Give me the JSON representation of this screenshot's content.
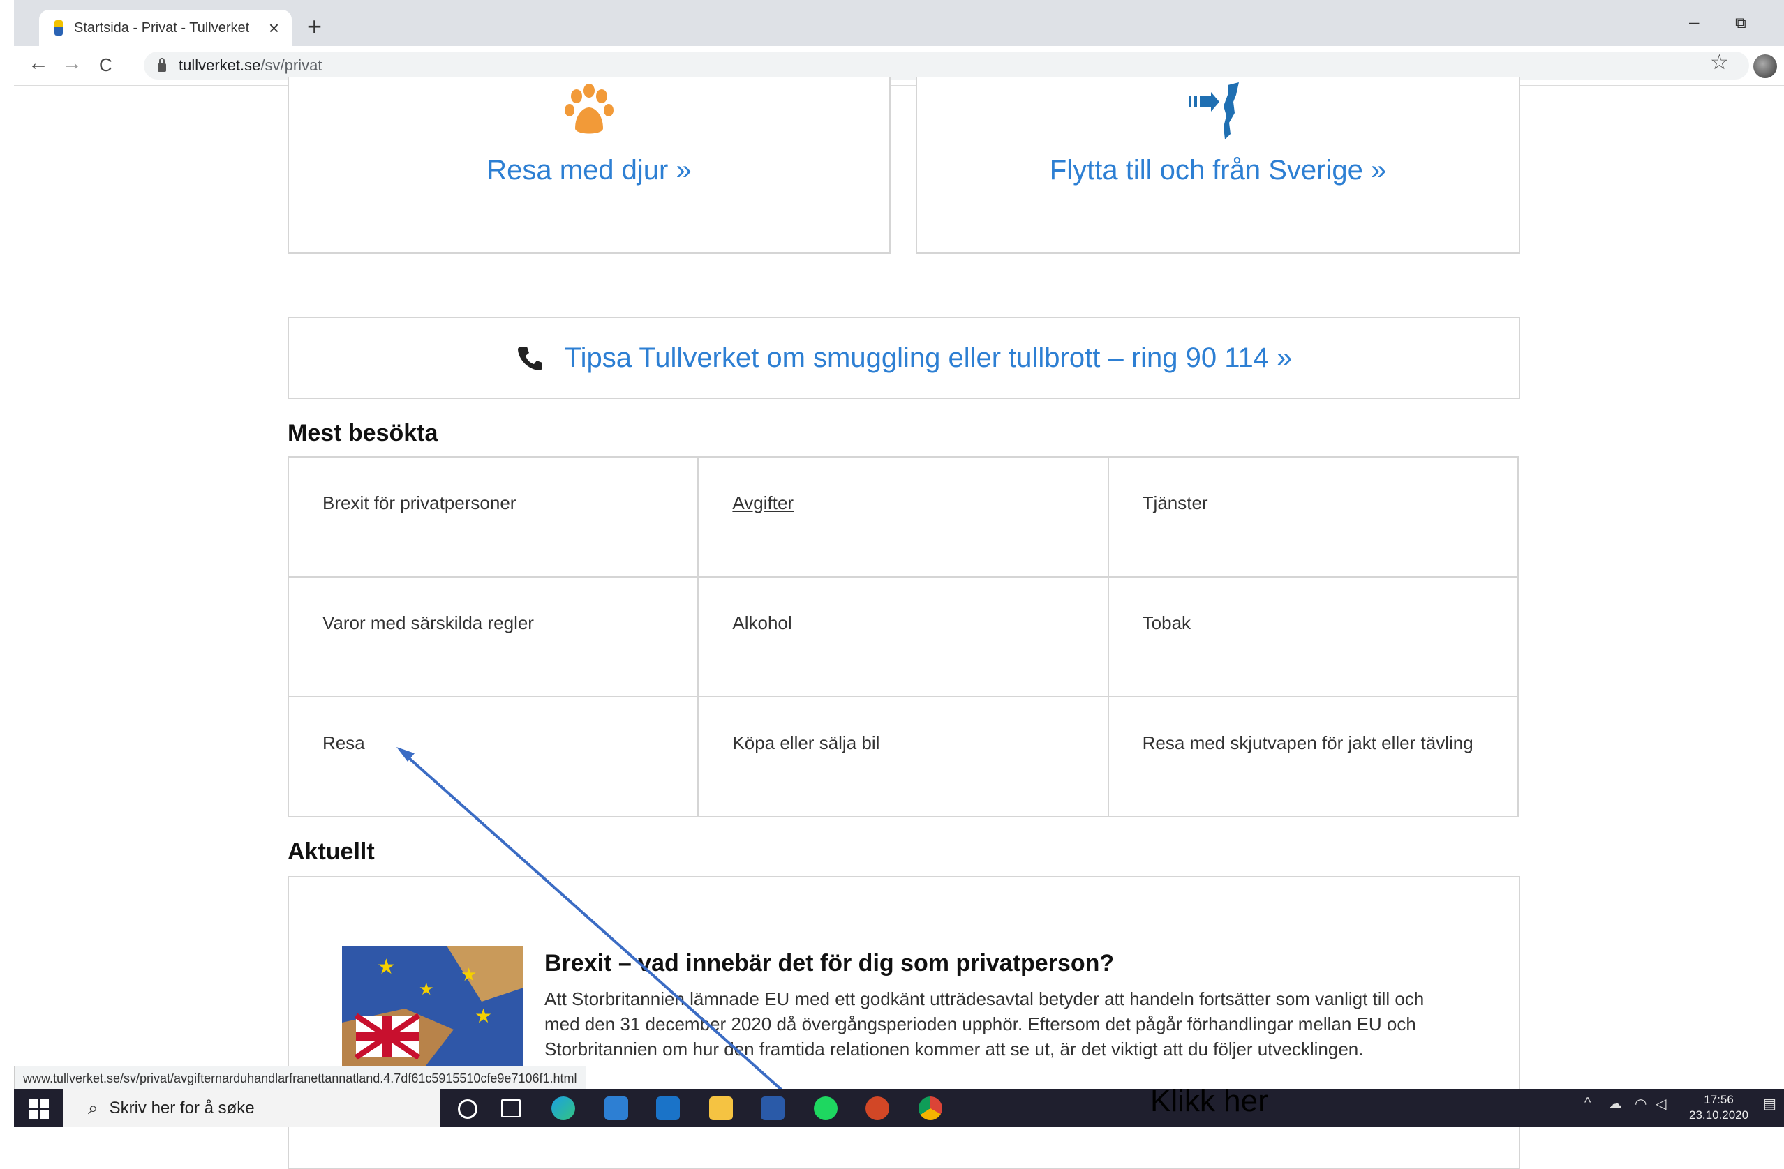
{
  "browser": {
    "tab_title": "Startsida - Privat - Tullverket",
    "tab_close": "×",
    "new_tab": "+",
    "url_domain": "tullverket.se",
    "url_path": "/sv/privat",
    "back": "←",
    "forward": "→",
    "reload": "C",
    "minimize": "–",
    "restore": "⧉",
    "star": "☆"
  },
  "cards": {
    "pets_label": "Resa med djur »",
    "move_label": "Flytta till och från Sverige »"
  },
  "tip": {
    "text": "Tipsa Tullverket om smuggling eller tullbrott – ring 90 114  »"
  },
  "most_visited": {
    "heading": "Mest besökta",
    "items": [
      "Brexit för privatpersoner",
      "Avgifter",
      "Tjänster",
      "Varor med särskilda regler",
      "Alkohol",
      "Tobak",
      "Resa",
      "Köpa eller sälja bil",
      "Resa med skjutvapen för jakt eller tävling"
    ]
  },
  "news": {
    "heading": "Aktuellt",
    "title": "Brexit – vad innebär det för dig som privatperson?",
    "body": "Att Storbritannien lämnade EU med ett godkänt utträdesavtal betyder att handeln fortsätter som vanligt till och med den 31 december 2020 då övergångsperioden upphör. Eftersom det pågår förhandlingar mellan EU och Storbritannien om hur den framtida relationen kommer att se ut, är det viktigt att du följer utvecklingen."
  },
  "status_url": "www.tullverket.se/sv/privat/avgifternarduhandlarfranettannatland.4.7df61c5915510cfe9e7106f1.html",
  "annotation": {
    "text": "Klikk her",
    "color": "#3b6cc4"
  },
  "taskbar": {
    "search_placeholder": "Skriv her for å søke",
    "time": "17:56",
    "date": "23.10.2020"
  },
  "colors": {
    "link": "#2d7fd3",
    "pet_icon": "#f29a38",
    "move_icon": "#1f6fb2"
  }
}
